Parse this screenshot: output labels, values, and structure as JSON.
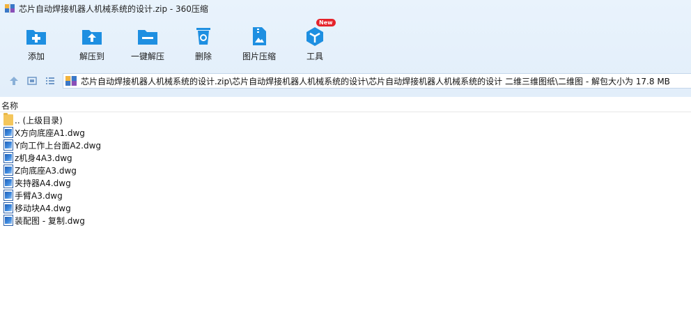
{
  "window": {
    "title": "芯片自动焊接机器人机械系统的设计.zip - 360压缩"
  },
  "toolbar": {
    "items": [
      {
        "label": "添加",
        "icon": "add-folder-icon"
      },
      {
        "label": "解压到",
        "icon": "extract-to-icon"
      },
      {
        "label": "一键解压",
        "icon": "one-click-extract-icon"
      },
      {
        "label": "删除",
        "icon": "recycle-bin-icon"
      },
      {
        "label": "图片压缩",
        "icon": "image-compress-icon"
      },
      {
        "label": "工具",
        "icon": "tools-cube-icon"
      }
    ],
    "new_badge": "New"
  },
  "nav": {
    "address": "芯片自动焊接机器人机械系统的设计.zip\\芯片自动焊接机器人机械系统的设计\\芯片自动焊接机器人机械系统的设计 二维三维图纸\\二维图 - 解包大小为 17.8 MB"
  },
  "list": {
    "column_name": "名称",
    "items": [
      {
        "name": ".. (上级目录)",
        "type": "folder"
      },
      {
        "name": "X方向底座A1.dwg",
        "type": "dwg"
      },
      {
        "name": "Y向工作上台面A2.dwg",
        "type": "dwg"
      },
      {
        "name": "z机身4A3.dwg",
        "type": "dwg"
      },
      {
        "name": "Z向底座A3.dwg",
        "type": "dwg"
      },
      {
        "name": "夹持器A4.dwg",
        "type": "dwg"
      },
      {
        "name": "手臂A3.dwg",
        "type": "dwg"
      },
      {
        "name": "移动块A4.dwg",
        "type": "dwg"
      },
      {
        "name": "装配图 - 复制.dwg",
        "type": "dwg"
      }
    ]
  },
  "colors": {
    "toolbar_bg": "#e6f1fb",
    "icon_blue": "#1e8fe1",
    "badge_red": "#e5232b"
  }
}
